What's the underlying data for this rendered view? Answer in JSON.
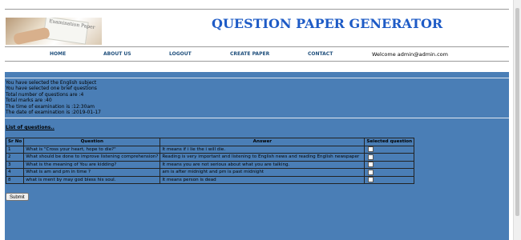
{
  "header": {
    "title": "QUESTION PAPER GENERATOR",
    "logo_text": "Examination Paper"
  },
  "nav": {
    "home": "HOME",
    "about": "ABOUT US",
    "logout": "LOGOUT",
    "create": "CREATE PAPER",
    "contact": "CONTACT",
    "welcome": "Welcome admin@admin.com"
  },
  "info": {
    "line1": "You have selected the English subject",
    "line2": "You have selected one brief questions",
    "line3": "Total number of questions are :4",
    "line4": "Total marks are :40",
    "line5": "The time of examination is :12:30am",
    "line6": "The date of examination is :2019-01-17"
  },
  "list_title": "List of questions..",
  "table": {
    "headers": [
      "Sr No",
      "Question",
      "Answer",
      "Selected question"
    ],
    "rows": [
      {
        "no": "1",
        "question": "What is \"Cross your heart, hope to die?\"",
        "answer": "It means if i lie the i will die."
      },
      {
        "no": "2",
        "question": "What should be done to improve listening comprehension?",
        "answer": "Reading is very important and listening to English news and reading English newspaper"
      },
      {
        "no": "3",
        "question": "What is the meaning of You are kidding?",
        "answer": "It means you are not serious about what you are talking."
      },
      {
        "no": "4",
        "question": "What is am and pm in time ?",
        "answer": "am is after midnight and pm is past midnight"
      },
      {
        "no": "8",
        "question": "what is ment by may god bless his soul.",
        "answer": "It means person is dead"
      }
    ]
  },
  "submit_label": "Submit",
  "colors": {
    "title": "#1e5bc6",
    "nav": "#1f4f7c",
    "content_bg": "#4a7eb6"
  }
}
